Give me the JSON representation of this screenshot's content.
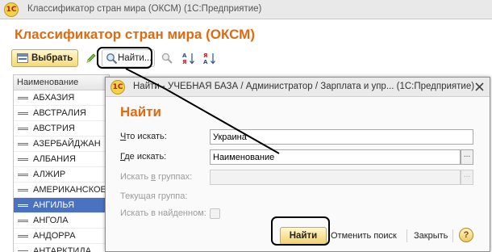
{
  "main_window": {
    "title": "Классификатор стран мира (ОКСМ)  (1С:Предприятие)",
    "logo": "1С"
  },
  "form": {
    "title": "Классификатор стран мира (ОКСМ)"
  },
  "toolbar": {
    "select_label": "Выбрать",
    "find_label": "Найти..."
  },
  "list": {
    "column_header": "Наименование",
    "rows": [
      "АБХАЗИЯ",
      "АВСТРАЛИЯ",
      "АВСТРИЯ",
      "АЗЕРБАЙДЖАН",
      "АЛБАНИЯ",
      "АЛЖИР",
      "АМЕРИКАНСКОЕ",
      "АНГИЛЬЯ",
      "АНГОЛА",
      "АНДОРРА",
      "АНТАРКТИДА"
    ],
    "selected_index": 7
  },
  "find_dialog": {
    "title": "Найти - УЧЕБНАЯ БАЗА / Администратор / Зарплата и упр...  (1С:Предприятие)",
    "heading": "Найти",
    "what_label_u": "Ч",
    "what_label_rest": "то искать:",
    "what_value": "Украина",
    "where_label_u": "Г",
    "where_label_rest": "де искать:",
    "where_value": "Наименование",
    "in_groups_label_a": "Искать ",
    "in_groups_label_u": "в",
    "in_groups_label_b": " группах:",
    "current_group_label": "Текущая группа:",
    "in_found_label": "Искать в найденном:",
    "find_button": "Найти",
    "cancel_search": "Отменить поиск",
    "close": "Закрыть",
    "help": "?"
  },
  "colors": {
    "accent_orange": "#e26a0d",
    "selection_blue": "#4a72c0",
    "button_yellow": "#f6d978"
  }
}
